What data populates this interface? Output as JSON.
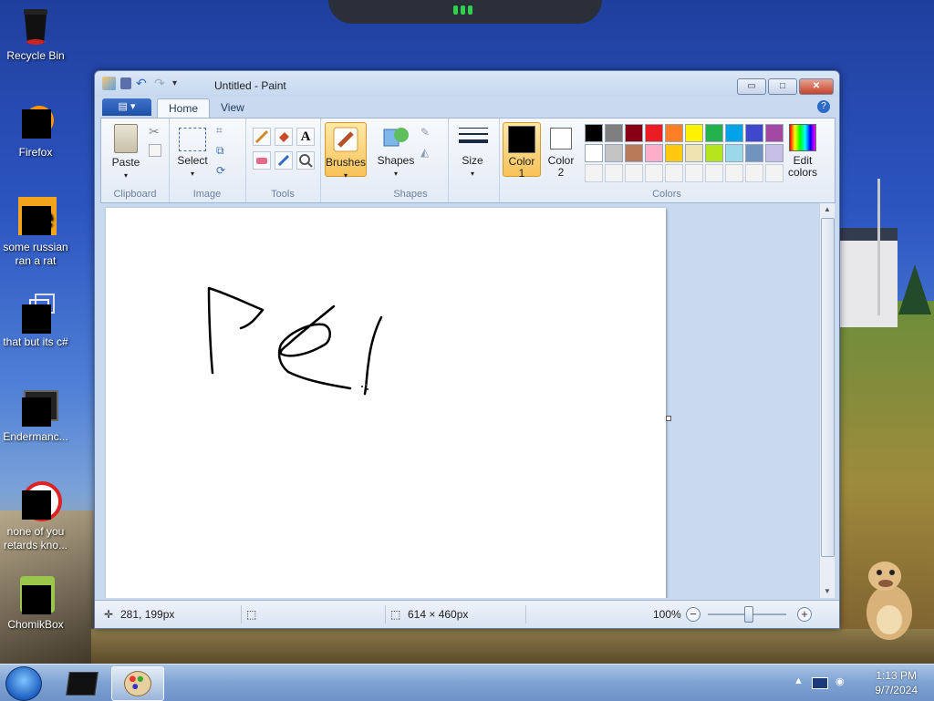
{
  "desktop": {
    "icons": [
      {
        "label": "Recycle Bin",
        "icon": "recycle-bin-icon"
      },
      {
        "label": "Firefox",
        "icon": "firefox-icon"
      },
      {
        "label": "some russian ran a rat",
        "icon": "app-icon"
      },
      {
        "label": "that but its c#",
        "icon": "app-icon"
      },
      {
        "label": "Endermanc...",
        "icon": "app-icon"
      },
      {
        "label": "none of you retards kno...",
        "icon": "app-icon"
      },
      {
        "label": "ChomikBox",
        "icon": "chomikbox-icon"
      }
    ]
  },
  "window": {
    "title": "Untitled - Paint",
    "controls": {
      "minimize": "▭",
      "maximize": "□",
      "close": "✕"
    }
  },
  "tabs": {
    "file": "▾",
    "home": "Home",
    "view": "View",
    "help": "?"
  },
  "ribbon": {
    "clipboard": {
      "label": "Clipboard",
      "paste": "Paste"
    },
    "image": {
      "label": "Image",
      "select": "Select"
    },
    "tools": {
      "label": "Tools"
    },
    "brushes": {
      "label": "Brushes"
    },
    "shapes": {
      "label": "Shapes",
      "shapes_btn": "Shapes"
    },
    "size": {
      "label": "Size"
    },
    "colors": {
      "label": "Colors",
      "color1": "Color",
      "color1_num": "1",
      "color2": "Color",
      "color2_num": "2",
      "edit": "Edit",
      "edit2": "colors",
      "palette_row1": [
        "#000000",
        "#7f7f7f",
        "#880015",
        "#ed1c24",
        "#ff7f27",
        "#fff200",
        "#22b14c",
        "#00a2e8",
        "#3f48cc",
        "#a349a4"
      ],
      "palette_row2": [
        "#ffffff",
        "#c3c3c3",
        "#b97a57",
        "#ffaec9",
        "#ffc90e",
        "#efe4b0",
        "#b5e61d",
        "#99d9ea",
        "#7092be",
        "#c8bfe7"
      ]
    }
  },
  "status": {
    "cursor_pos": "281, 199px",
    "canvas_size": "614 × 460px",
    "zoom": "100%"
  },
  "taskbar": {
    "time": "1:13 PM",
    "date": "9/7/2024"
  }
}
